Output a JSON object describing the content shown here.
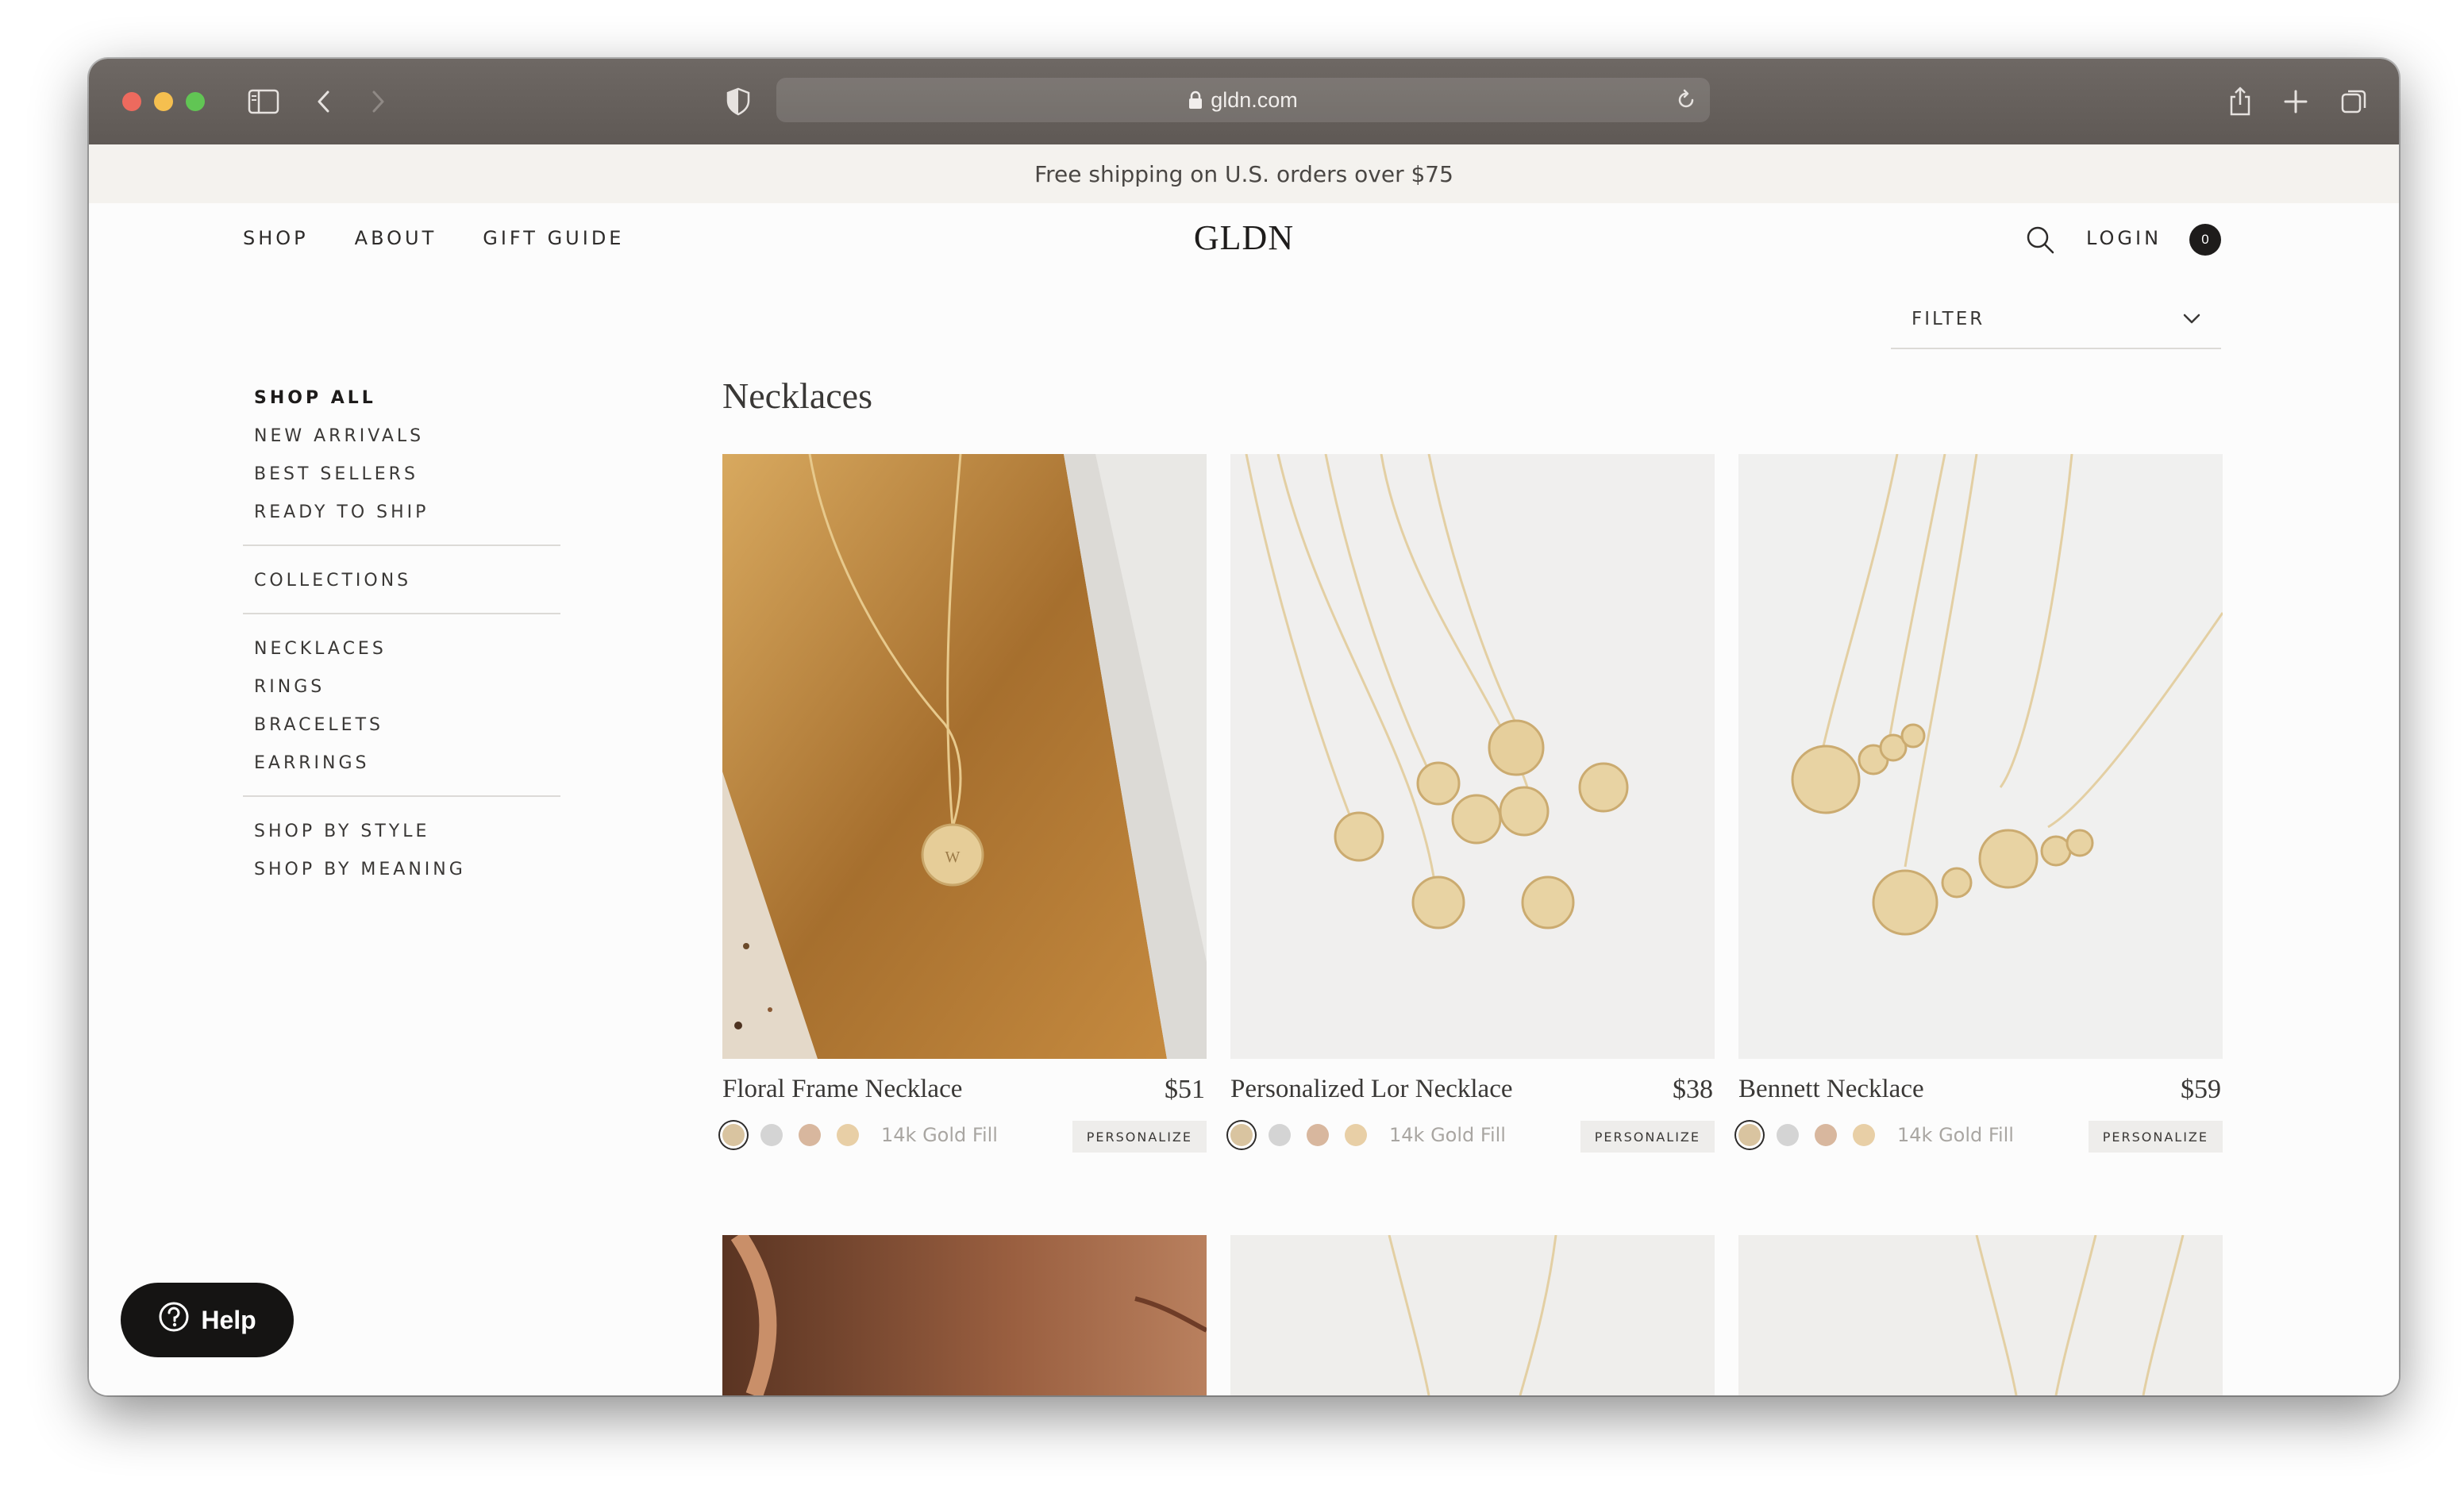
{
  "browser": {
    "url": "gldn.com",
    "icons": [
      "sidebar-icon",
      "back-icon",
      "forward-icon",
      "shield-icon",
      "lock-icon",
      "reload-icon",
      "share-icon",
      "new-tab-icon",
      "tabs-overview-icon"
    ]
  },
  "banner": {
    "text": "Free shipping on U.S. orders over $75"
  },
  "header": {
    "nav": [
      "SHOP",
      "ABOUT",
      "GIFT GUIDE"
    ],
    "logo": "GLDN",
    "login": "LOGIN",
    "cart_count": "0"
  },
  "filter": {
    "label": "FILTER"
  },
  "sidebar": {
    "group1": [
      "SHOP ALL",
      "NEW ARRIVALS",
      "BEST SELLERS",
      "READY TO SHIP"
    ],
    "group2": [
      "COLLECTIONS"
    ],
    "group3": [
      "NECKLACES",
      "RINGS",
      "BRACELETS",
      "EARRINGS"
    ],
    "group4": [
      "SHOP BY STYLE",
      "SHOP BY MEANING"
    ]
  },
  "page": {
    "heading": "Necklaces"
  },
  "products": [
    {
      "name": "Floral Frame Necklace",
      "price": "$51",
      "material": "14k Gold Fill",
      "action": "PERSONALIZE"
    },
    {
      "name": "Personalized Lor Necklace",
      "price": "$38",
      "material": "14k Gold Fill",
      "action": "PERSONALIZE"
    },
    {
      "name": "Bennett Necklace",
      "price": "$59",
      "material": "14k Gold Fill",
      "action": "PERSONALIZE"
    }
  ],
  "swatch_colors": [
    "#d9c4a0",
    "#d4d4d4",
    "#d8b79e",
    "#e8cfa6"
  ],
  "help": {
    "label": "Help"
  },
  "colors": {
    "banner_bg": "#f4f2ee",
    "text": "#3a3836",
    "dark": "#151413"
  }
}
